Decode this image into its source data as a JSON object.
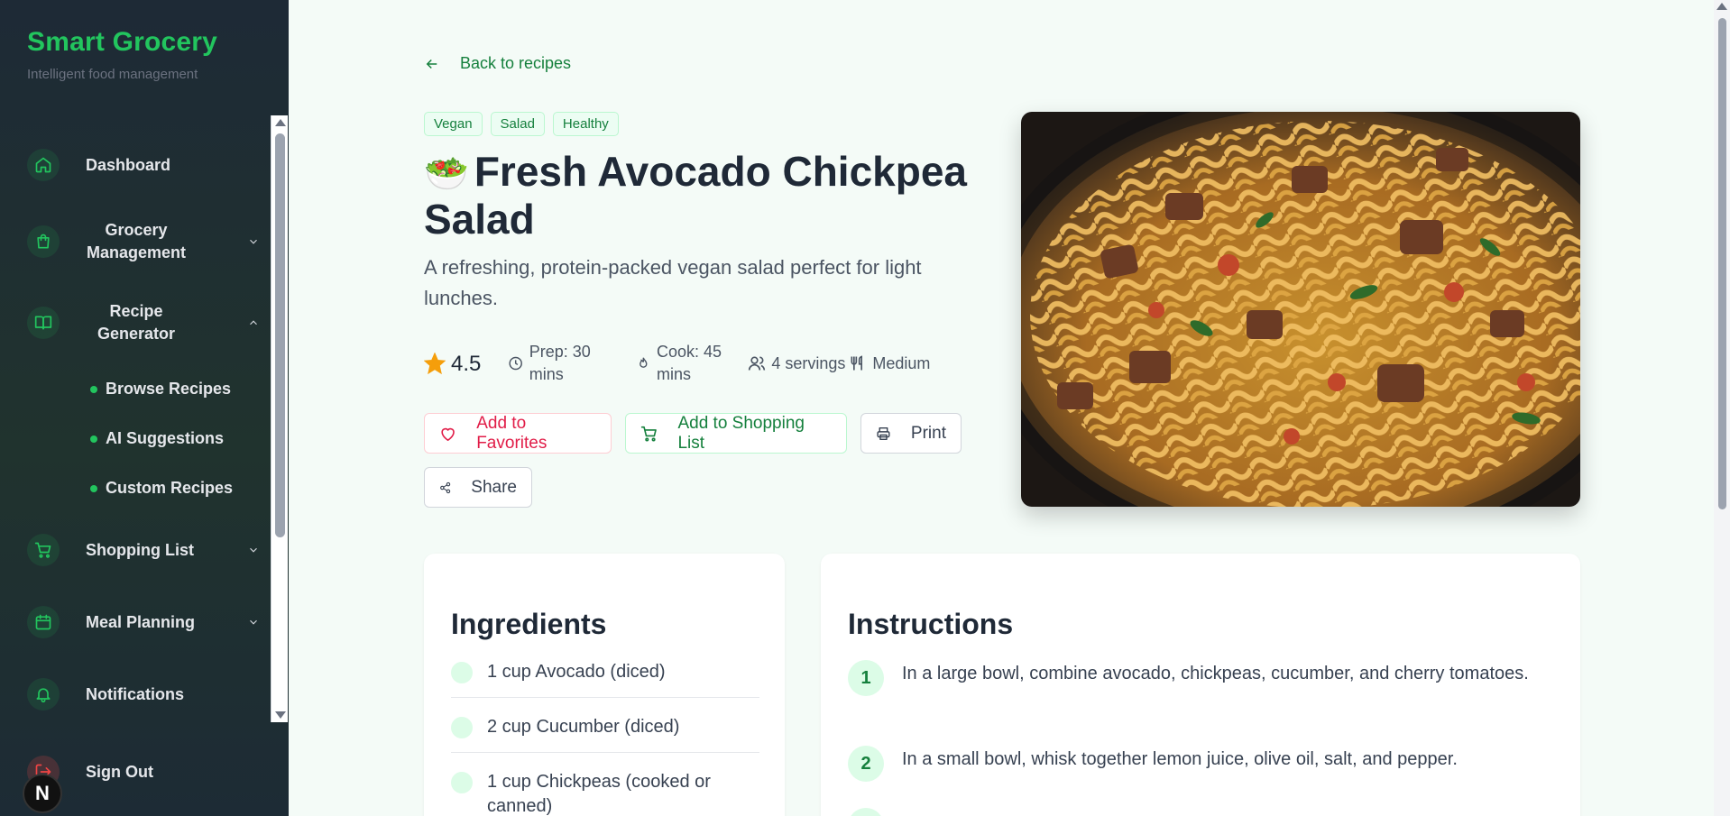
{
  "brand": {
    "title": "Smart Grocery",
    "subtitle": "Intelligent food management"
  },
  "sidebar": {
    "items": [
      {
        "label": "Dashboard",
        "icon": "home-icon"
      },
      {
        "label": "Grocery Management",
        "icon": "shopping-bag-icon",
        "expanded": false
      },
      {
        "label": "Recipe Generator",
        "icon": "book-icon",
        "expanded": true
      },
      {
        "label": "Shopping List",
        "icon": "cart-icon",
        "expanded": false
      },
      {
        "label": "Meal Planning",
        "icon": "calendar-icon",
        "expanded": false
      },
      {
        "label": "Notifications",
        "icon": "bell-icon"
      }
    ],
    "recipe_sub": [
      "Browse Recipes",
      "AI Suggestions",
      "Custom Recipes"
    ],
    "signout": "Sign Out",
    "badge": "N"
  },
  "recipe": {
    "back_label": "Back to recipes",
    "tags": [
      "Vegan",
      "Salad",
      "Healthy"
    ],
    "emoji": "🥗",
    "title": "Fresh Avocado Chickpea Salad",
    "description": "A refreshing, protein-packed vegan salad perfect for light lunches.",
    "rating": "4.5",
    "prep": "Prep: 30 mins",
    "cook": "Cook: 45 mins",
    "servings": "4 servings",
    "difficulty": "Medium",
    "buttons": {
      "favorite": "Add to Favorites",
      "shopping": "Add to Shopping List",
      "print": "Print",
      "share": "Share"
    }
  },
  "ingredients": {
    "title": "Ingredients",
    "items": [
      "1 cup Avocado (diced)",
      "2 cup Cucumber (diced)",
      "1 cup Chickpeas (cooked or canned)"
    ]
  },
  "instructions": {
    "title": "Instructions",
    "steps": [
      {
        "num": "1",
        "text": "In a large bowl, combine avocado, chickpeas, cucumber, and cherry tomatoes."
      },
      {
        "num": "2",
        "text": "In a small bowl, whisk together lemon juice, olive oil, salt, and pepper."
      }
    ]
  },
  "colors": {
    "accent": "#22c55e",
    "accent_dark": "#15803d",
    "favorite": "#e11d48",
    "sidebar_bg": "#1e2a36"
  }
}
